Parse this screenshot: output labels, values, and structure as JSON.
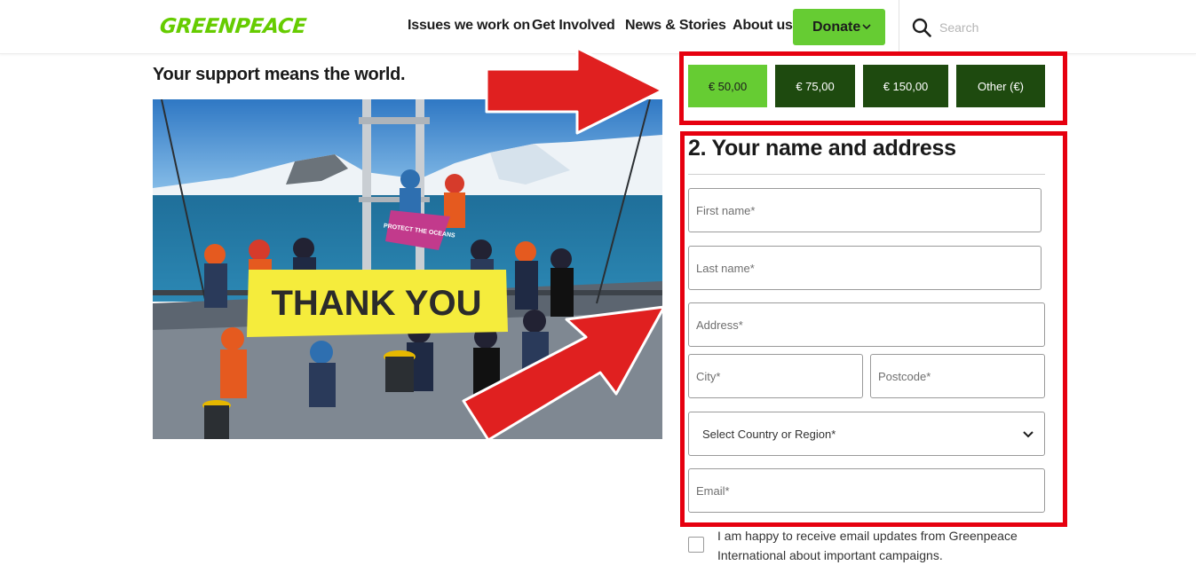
{
  "header": {
    "logo_text": "GREENPEACE",
    "nav": [
      "Issues we work on",
      "Get Involved",
      "News & Stories",
      "About us"
    ],
    "donate_label": "Donate",
    "search_placeholder": "Search"
  },
  "left": {
    "heading": "Your support means the world.",
    "photo": {
      "banner_text": "THANK YOU",
      "flag_text": "PROTECT THE OCEANS"
    }
  },
  "amounts": [
    {
      "label": "€ 50,00",
      "selected": true
    },
    {
      "label": "€ 75,00",
      "selected": false
    },
    {
      "label": "€ 150,00",
      "selected": false
    },
    {
      "label": "Other (€)",
      "selected": false
    }
  ],
  "form": {
    "title": "2. Your name and address",
    "first_name_placeholder": "First name*",
    "last_name_placeholder": "Last name*",
    "address_placeholder": "Address*",
    "city_placeholder": "City*",
    "postcode_placeholder": "Postcode*",
    "country_label": "Select Country or Region*",
    "email_placeholder": "Email*",
    "consent_text": "I am happy to receive email updates from Greenpeace International about important campaigns."
  },
  "colors": {
    "brand_green": "#66cc33",
    "dark_green": "#1e4a0f",
    "annotation_red": "#e6000f"
  }
}
